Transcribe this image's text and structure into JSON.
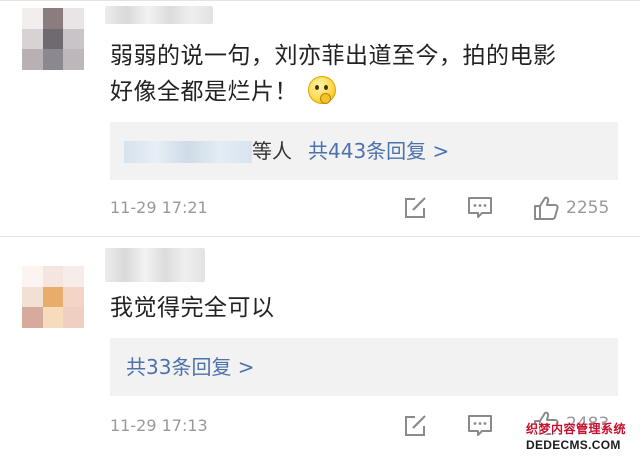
{
  "comments": [
    {
      "text_line1": "弱弱的说一句，刘亦菲出道至今，拍的电影",
      "text_line2": "好像全都是烂片！",
      "emoji_icon": "thinking-face-emoji",
      "reply_suffix": "等人",
      "reply_link": "共443条回复 >",
      "time": "11-29 17:21",
      "likes": "2255",
      "avatar_colors": [
        "#f2eeee",
        "#8b7c80",
        "#e9e4e5",
        "#d9d2d4",
        "#6f6a70",
        "#c9c4c8",
        "#b8b0b4",
        "#8c8890",
        "#bdb6ba"
      ]
    },
    {
      "text_line1": "我觉得完全可以",
      "reply_link": "共33条回复 >",
      "time": "11-29 17:13",
      "likes": "2483",
      "avatar_colors": [
        "#fbf4f1",
        "#f4e6de",
        "#f6ecea",
        "#f3e0d4",
        "#e9ad6b",
        "#f4d4c6",
        "#d7aa9e",
        "#f7dcbc",
        "#efcfc2"
      ]
    }
  ],
  "icons": {
    "edit": "edit-icon",
    "comment": "comment-icon",
    "like": "thumbs-up-icon"
  },
  "colors": {
    "link": "#4c72ab",
    "muted": "#999999",
    "reply_bg": "#f2f2f2"
  },
  "watermark": {
    "line1": "织梦内容管理系统",
    "line2": "DEDECMS.COM"
  }
}
